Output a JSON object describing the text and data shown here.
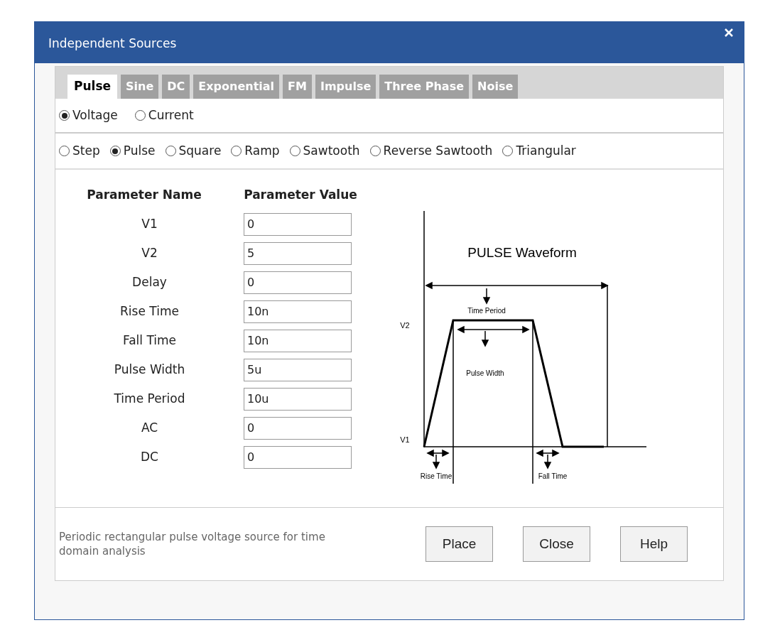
{
  "window": {
    "title": "Independent Sources"
  },
  "tabs": [
    {
      "label": "Pulse",
      "selected": true
    },
    {
      "label": "Sine",
      "selected": false
    },
    {
      "label": "DC",
      "selected": false
    },
    {
      "label": "Exponential",
      "selected": false
    },
    {
      "label": "FM",
      "selected": false
    },
    {
      "label": "Impulse",
      "selected": false
    },
    {
      "label": "Three Phase",
      "selected": false
    },
    {
      "label": "Noise",
      "selected": false
    }
  ],
  "source_type": [
    {
      "label": "Voltage",
      "selected": true
    },
    {
      "label": "Current",
      "selected": false
    }
  ],
  "waveform_type": [
    {
      "label": "Step",
      "selected": false
    },
    {
      "label": "Pulse",
      "selected": true
    },
    {
      "label": "Square",
      "selected": false
    },
    {
      "label": "Ramp",
      "selected": false
    },
    {
      "label": "Sawtooth",
      "selected": false
    },
    {
      "label": "Reverse Sawtooth",
      "selected": false
    },
    {
      "label": "Triangular",
      "selected": false
    }
  ],
  "parameters": {
    "columns": [
      "Parameter Name",
      "Parameter Value"
    ],
    "rows": [
      {
        "name": "V1",
        "value": "0"
      },
      {
        "name": "V2",
        "value": "5"
      },
      {
        "name": "Delay",
        "value": "0"
      },
      {
        "name": "Rise Time",
        "value": "10n"
      },
      {
        "name": "Fall Time",
        "value": "10n"
      },
      {
        "name": "Pulse Width",
        "value": "5u"
      },
      {
        "name": "Time Period",
        "value": "10u"
      },
      {
        "name": "AC",
        "value": "0"
      },
      {
        "name": "DC",
        "value": "0"
      }
    ]
  },
  "diagram": {
    "title": "PULSE Waveform",
    "v2_label": "V2",
    "v1_label": "V1",
    "period_label": "Time Period",
    "width_label": "Pulse Width",
    "rise_label": "Rise Time",
    "fall_label": "Fall Time"
  },
  "description": "Periodic rectangular pulse voltage source for time domain analysis",
  "buttons": [
    "Place",
    "Close",
    "Help"
  ]
}
